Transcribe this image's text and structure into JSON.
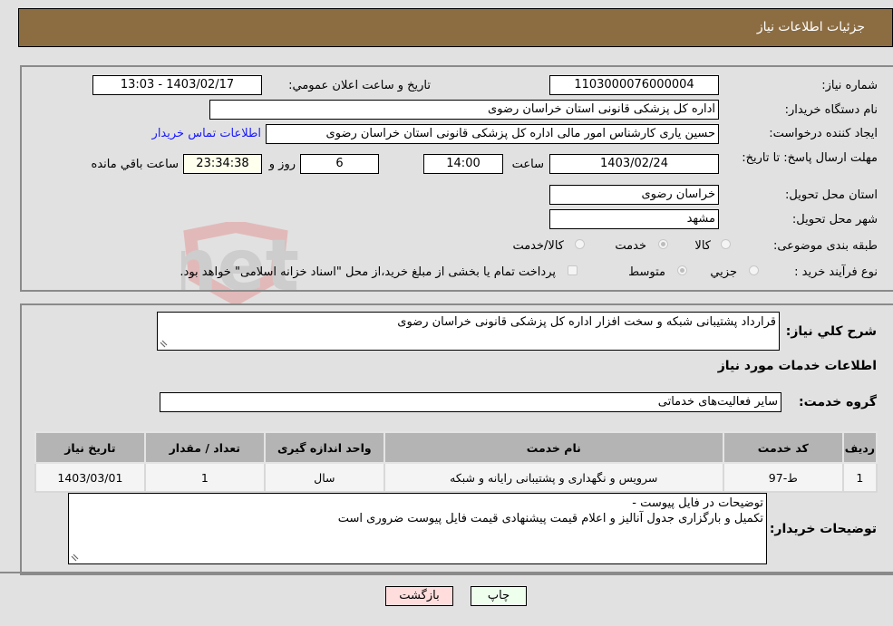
{
  "header": {
    "title": "جزئیات اطلاعات نیاز"
  },
  "fields": {
    "need_number": {
      "label": "شماره نیاز:",
      "value": "1103000076000004"
    },
    "announce_datetime": {
      "label": "تاریخ و ساعت اعلان عمومي:",
      "value": "1403/02/17 - 13:03"
    },
    "buyer_org": {
      "label": "نام دستگاه خریدار:",
      "value": "اداره کل پزشکی قانونی استان خراسان رضوی"
    },
    "requester": {
      "label": "ایجاد کننده درخواست:",
      "value": "حسین یاری کارشناس امور مالی اداره کل پزشکی قانونی استان خراسان رضوی",
      "contact_link": "اطلاعات تماس خریدار"
    },
    "deadline": {
      "label": "مهلت ارسال پاسخ: تا تاریخ:",
      "date": "1403/02/24",
      "time_label": "ساعت",
      "time": "14:00",
      "days": "6",
      "days_label": "روز و",
      "remaining": "23:34:38",
      "remaining_label": "ساعت باقي مانده"
    },
    "delivery_province": {
      "label": "استان محل تحویل:",
      "value": "خراسان رضوی"
    },
    "delivery_city": {
      "label": "شهر محل تحویل:",
      "value": "مشهد"
    },
    "category": {
      "label": "طبقه بندی موضوعی:",
      "options": [
        "کالا",
        "خدمت",
        "کالا/خدمت"
      ],
      "selected": "خدمت"
    },
    "purchase_type": {
      "label": "نوع فرآیند خرید :",
      "options": [
        "جزيي",
        "متوسط"
      ],
      "selected": "متوسط",
      "treasury_note": "پرداخت تمام یا بخشی از مبلغ خرید،از محل \"اسناد خزانه اسلامی\" خواهد بود.",
      "treasury_checked": false
    }
  },
  "description": {
    "label": "شرح کلي نیاز:",
    "value": "قرارداد پشتیبانی شبکه و سخت افزار اداره کل پزشکی قانونی خراسان رضوی"
  },
  "services_section": {
    "title": "اطلاعات خدمات مورد نیاز",
    "group_label": "گروه خدمت:",
    "group_value": "سایر فعالیت‌های خدماتی",
    "table": {
      "headers": [
        "ردیف",
        "کد خدمت",
        "نام خدمت",
        "واحد اندازه گیری",
        "تعداد / مقدار",
        "تاریخ نیاز"
      ],
      "rows": [
        [
          "1",
          "ط-97",
          "سرویس و نگهداری و پشتیبانی رایانه و شبکه",
          "سال",
          "1",
          "1403/03/01"
        ]
      ]
    }
  },
  "buyer_notes": {
    "label": "توضیحات خریدار:",
    "line1": "توضیحات در فایل پیوست -",
    "line2": "تکمیل و بارگزاری جدول آنالیز و اعلام قیمت پیشنهادی قیمت فایل پیوست ضروری است"
  },
  "buttons": {
    "print": "چاپ",
    "back": "بازگشت"
  },
  "colors": {
    "header_bg": "#8c6d42",
    "print_bg": "#eeffee",
    "back_bg": "#ffdddd",
    "link": "#1a1aff"
  },
  "watermark": "AriaTender.net"
}
